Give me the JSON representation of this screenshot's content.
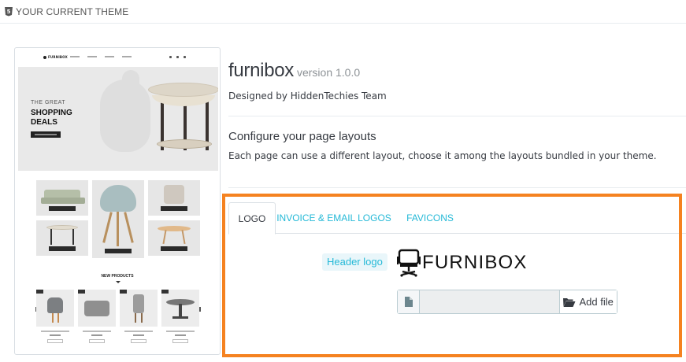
{
  "panel": {
    "title": "YOUR CURRENT THEME",
    "icon": "html5-icon"
  },
  "preview": {
    "logo": "FURNIBOX",
    "hero_small": "THE GREAT",
    "hero_big": "SHOPPING DEALS",
    "new_products": "NEW PRODUCTS"
  },
  "theme": {
    "name": "furnibox",
    "version": "version 1.0.0",
    "designed_by": "Designed by HiddenTechies Team"
  },
  "layouts": {
    "title": "Configure your page layouts",
    "description": "Each page can use a different layout, choose it among the layouts bundled in your theme."
  },
  "tabs": [
    {
      "label": "LOGO",
      "active": true
    },
    {
      "label": "INVOICE & EMAIL LOGOS",
      "active": false
    },
    {
      "label": "FAVICONS",
      "active": false
    }
  ],
  "logo_form": {
    "label": "Header logo",
    "logo_text": "FURNIBOX",
    "add_file": "Add file",
    "file_value": ""
  },
  "colors": {
    "accent": "#25b9d7",
    "highlight": "#f58220",
    "text": "#363a41"
  }
}
